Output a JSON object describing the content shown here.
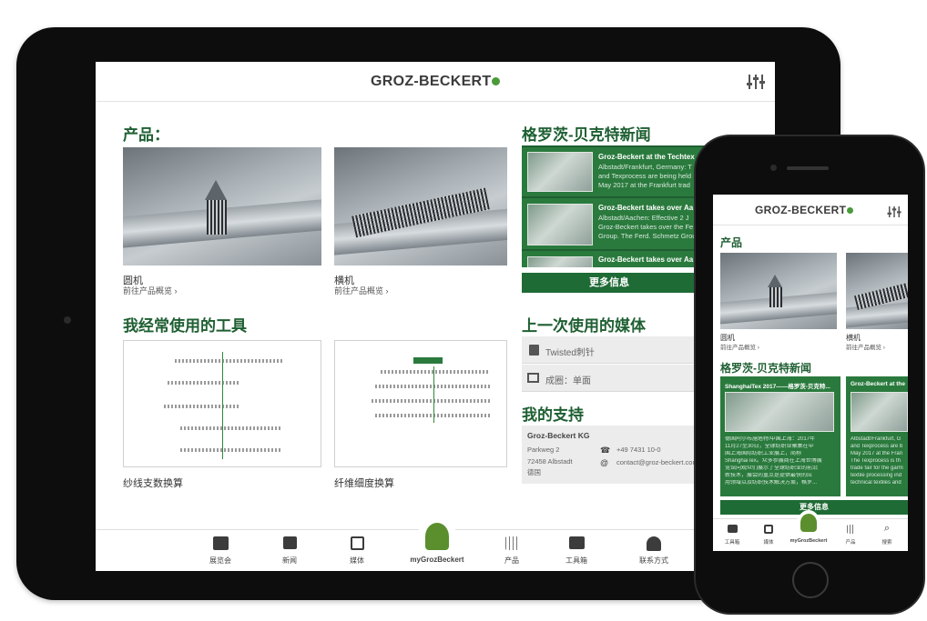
{
  "tablet": {
    "header": {
      "logo": "GROZ-BECKERT"
    },
    "products": {
      "title": "产品：",
      "items": [
        {
          "name": "圆机",
          "link": "前往产品概览 ›"
        },
        {
          "name": "横机",
          "link": "前往产品概览 ›"
        }
      ]
    },
    "tools": {
      "title": "我经常使用的工具",
      "items": [
        {
          "name": "纱线支数换算"
        },
        {
          "name": "纤维细度换算"
        }
      ]
    },
    "news": {
      "title": "格罗茨-贝克特新闻",
      "items": [
        {
          "title": "Groz-Beckert at the Techtex",
          "lines": [
            "Albstadt/Frankfurt, Germany: T",
            "and Texprocess are being held",
            "May 2017 at the Frankfurt trad"
          ]
        },
        {
          "title": "Groz-Beckert takes over Aa",
          "lines": [
            "Albstadt/Aachen: Effective 2 J",
            "Groz-Beckert takes over the Fe",
            "Group. The Ferd. Schmetz Grou"
          ]
        },
        {
          "title": "Groz-Beckert takes over Aa",
          "lines": []
        }
      ],
      "more": "更多信息"
    },
    "media": {
      "title": "上一次使用的媒体",
      "items": [
        {
          "label": "Twisted刺针",
          "icon": "document-icon"
        },
        {
          "label": "成圈：单面",
          "icon": "video-icon"
        }
      ]
    },
    "support": {
      "title": "我的支持",
      "company": "Groz-Beckert KG",
      "street": "Parkweg 2",
      "city": "72458 Albstadt",
      "country": "德国",
      "phone": "+49 7431 10-0",
      "email": "contact@groz-beckert.com"
    },
    "tabs": [
      {
        "label": "展览会",
        "icon": "calendar-icon"
      },
      {
        "label": "新闻",
        "icon": "news-icon"
      },
      {
        "label": "媒体",
        "icon": "media-icon"
      },
      {
        "label": "myGrozBeckert",
        "icon": "user-icon"
      },
      {
        "label": "产品",
        "icon": "product-icon"
      },
      {
        "label": "工具箱",
        "icon": "toolbox-icon"
      },
      {
        "label": "联系方式",
        "icon": "contact-icon"
      }
    ]
  },
  "phone": {
    "header": {
      "logo": "GROZ-BECKERT"
    },
    "products": {
      "title": "产品",
      "items": [
        {
          "name": "圆机",
          "link": "前往产品概览 ›"
        },
        {
          "name": "横机",
          "link": "前往产品概览 ›"
        }
      ]
    },
    "news": {
      "title": "格罗茨-贝克特新闻",
      "items": [
        {
          "title": "ShanghaiTex 2017——格罗茨-贝克特...",
          "lines": [
            "德国阿尔布施塔特/中国上海：2017年",
            "11月27至30日，全球纺织业聚集在中",
            "国上海国际纺织工业展上，简称",
            "ShanghaiTex。众多参展商在上海世博展",
            "览馆向观众们展示了全球纺织业的前沿",
            "新技术，展会的重点是提供最快的应",
            "用领域以及纺织技术解决方案，格罗..."
          ]
        },
        {
          "title": "Groz-Beckert at the",
          "lines": [
            "Albstadt/Frankfurt, G",
            "and Texprocess are b",
            "May 2017 at the Fran",
            "The Texprocess is th",
            "trade fair for the garm",
            "textile processing ind",
            "technical textiles and"
          ]
        }
      ],
      "more": "更多信息"
    },
    "tabs": [
      {
        "label": "工具箱",
        "icon": "toolbox-icon"
      },
      {
        "label": "媒体",
        "icon": "media-icon"
      },
      {
        "label": "myGrozBeckert",
        "icon": "user-icon"
      },
      {
        "label": "产品",
        "icon": "product-icon"
      },
      {
        "label": "搜索",
        "icon": "search-icon"
      }
    ]
  },
  "colors": {
    "brand_green": "#1f6b35",
    "heading_green": "#1e5f32",
    "logo_dot": "#4a9a3a"
  }
}
